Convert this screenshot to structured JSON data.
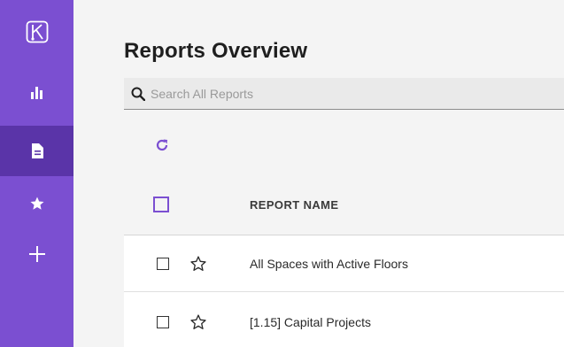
{
  "sidebar": {
    "items": [
      {
        "icon": "logo-icon"
      },
      {
        "icon": "bar-chart-icon"
      },
      {
        "icon": "document-icon",
        "active": true
      },
      {
        "icon": "star-icon"
      },
      {
        "icon": "plus-icon"
      }
    ],
    "colors": {
      "background": "#7b4fd1",
      "active": "#5a34a8"
    }
  },
  "main": {
    "title": "Reports Overview",
    "search": {
      "placeholder": "Search All Reports",
      "value": ""
    },
    "refresh_icon": "refresh-icon",
    "table": {
      "columns": [
        "REPORT NAME"
      ],
      "rows": [
        {
          "name": "All Spaces with Active Floors"
        },
        {
          "name": "[1.15] Capital Projects"
        }
      ]
    },
    "accent_color": "#7b4fd1"
  }
}
